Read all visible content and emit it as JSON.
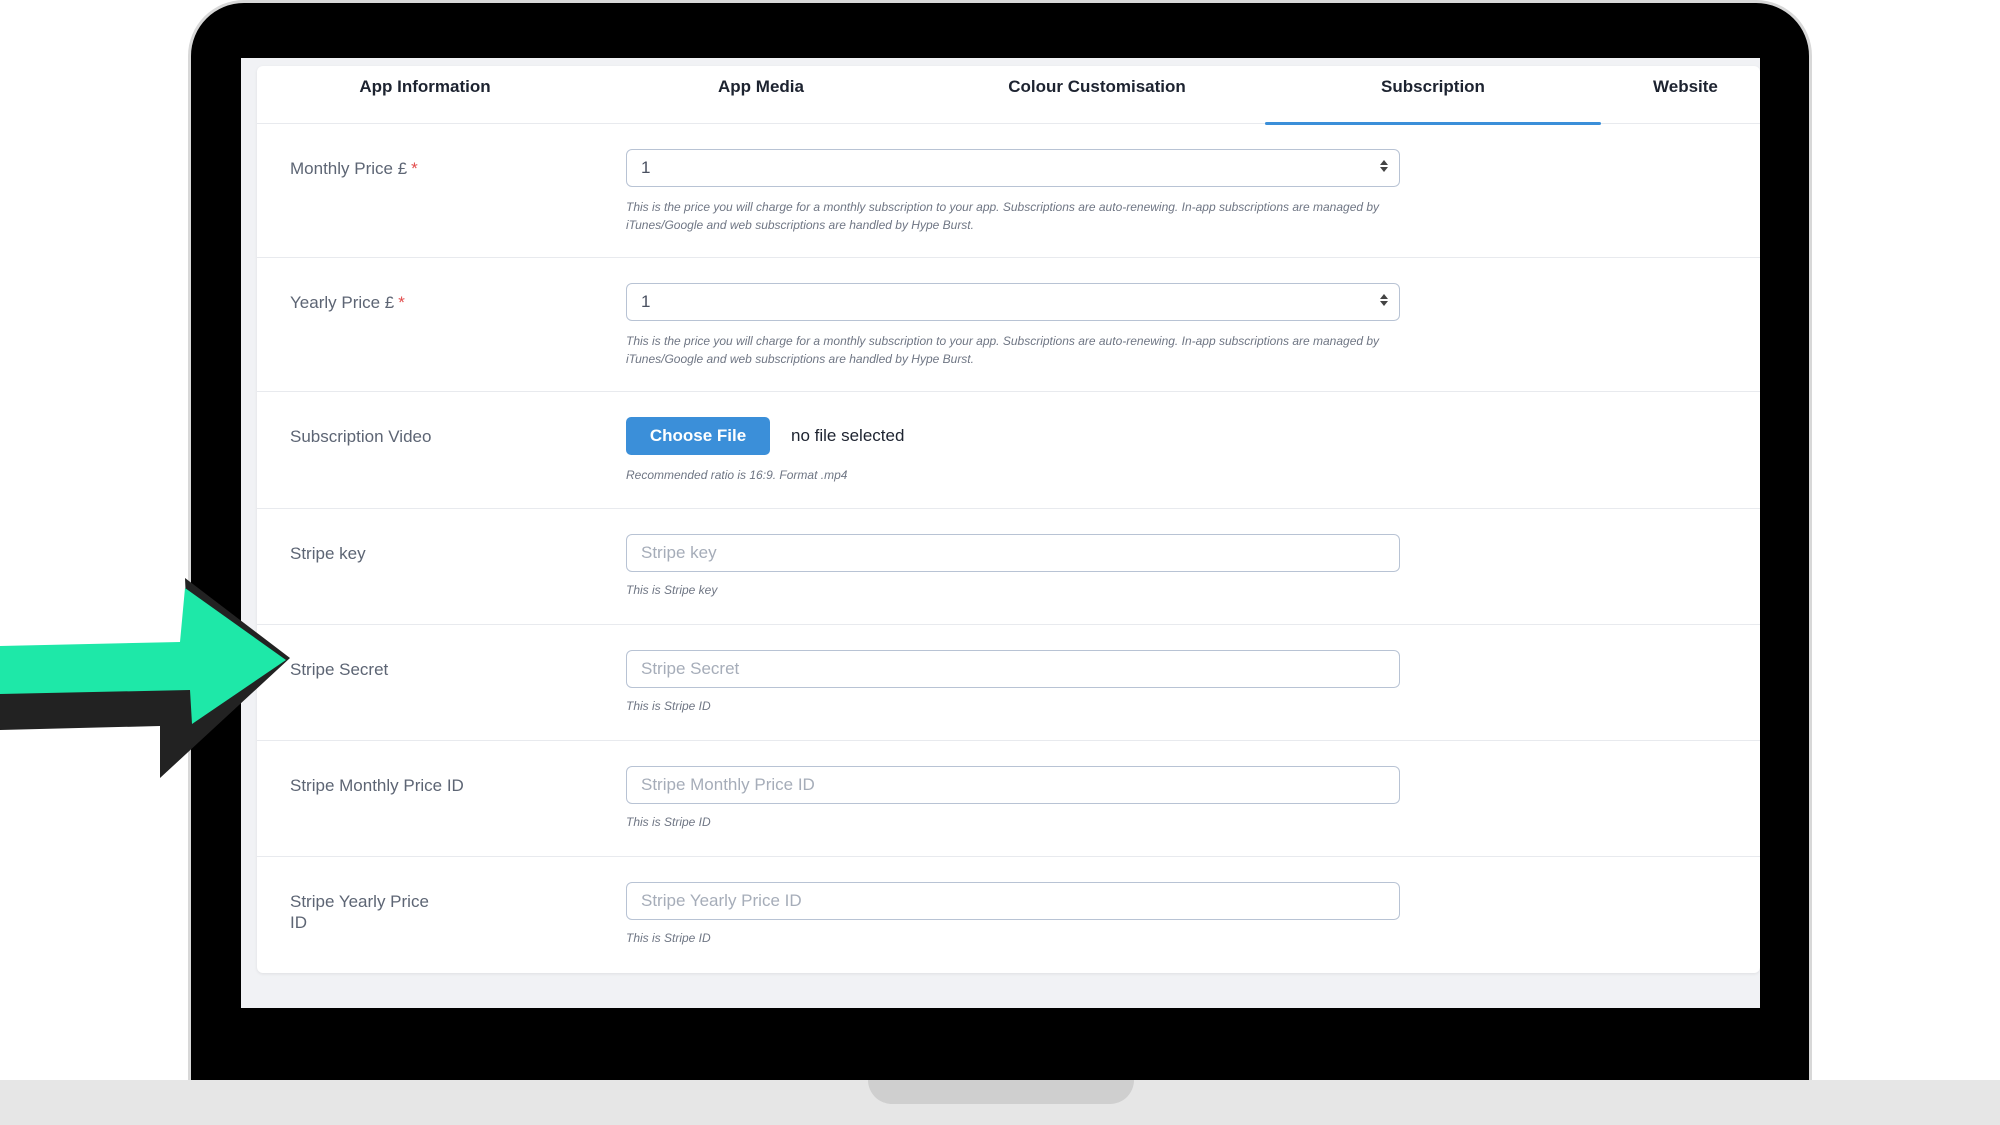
{
  "tabs": [
    {
      "label": "App Information"
    },
    {
      "label": "App Media"
    },
    {
      "label": "Colour Customisation"
    },
    {
      "label": "Subscription",
      "active": true
    },
    {
      "label": "Website"
    }
  ],
  "form": {
    "monthly_price": {
      "label": "Monthly Price £",
      "required": "*",
      "value": "1",
      "help": "This is the price you will charge for a monthly subscription to your app. Subscriptions are auto-renewing. In-app subscriptions are managed by iTunes/Google and web subscriptions are handled by Hype Burst."
    },
    "yearly_price": {
      "label": "Yearly Price £",
      "required": "*",
      "value": "1",
      "help": "This is the price you will charge for a monthly subscription to your app. Subscriptions are auto-renewing. In-app subscriptions are managed by iTunes/Google and web subscriptions are handled by Hype Burst."
    },
    "subscription_video": {
      "label": "Subscription Video",
      "button": "Choose File",
      "status": "no file selected",
      "help": "Recommended ratio is 16:9. Format .mp4"
    },
    "stripe_key": {
      "label": "Stripe key",
      "placeholder": "Stripe key",
      "help": "This is Stripe key"
    },
    "stripe_secret": {
      "label": "Stripe Secret",
      "placeholder": "Stripe Secret",
      "help": "This is Stripe ID"
    },
    "stripe_monthly_price_id": {
      "label": "Stripe Monthly Price ID",
      "placeholder": "Stripe Monthly Price ID",
      "help": "This is Stripe ID"
    },
    "stripe_yearly_price_id": {
      "label": "Stripe Yearly Price ID",
      "placeholder": "Stripe Yearly Price ID",
      "help": "This is Stripe ID"
    }
  },
  "colors": {
    "accent": "#3b8fd9",
    "arrow": "#1ee8a8",
    "required": "#e24c4c"
  }
}
